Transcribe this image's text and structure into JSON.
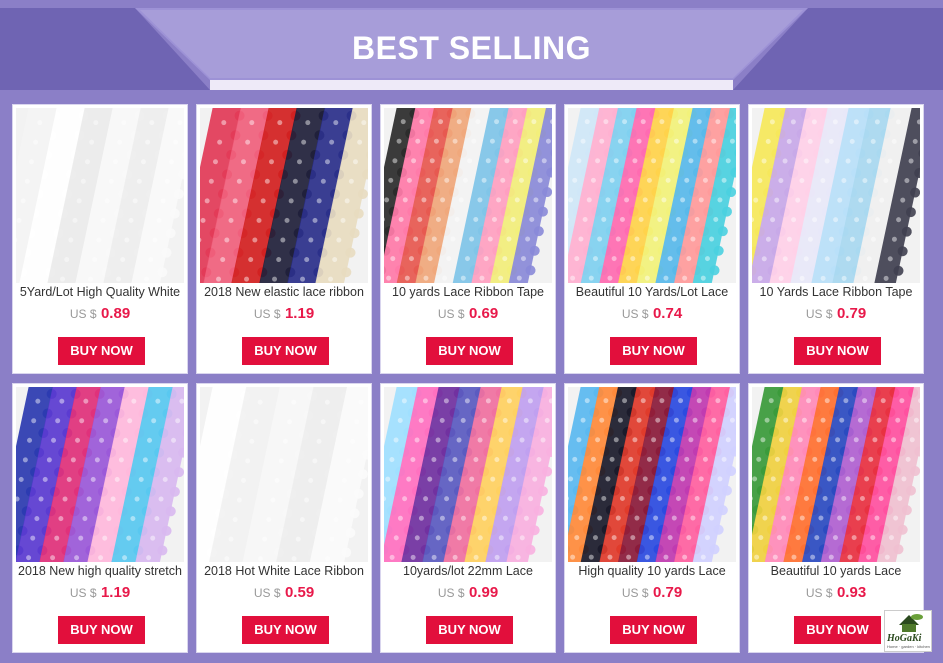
{
  "header": {
    "title": "BEST SELLING"
  },
  "brand": {
    "name": "HoGaKi",
    "tagline": "Home · garden · kitchen"
  },
  "colors": {
    "background": "#8b7fc7",
    "button": "#e20f3c",
    "price": "#e8194a"
  },
  "products": [
    {
      "title": "5Yard/Lot High Quality White",
      "currency": "US $",
      "price": "0.89",
      "button": "BUY NOW"
    },
    {
      "title": "2018 New elastic lace ribbon",
      "currency": "US $",
      "price": "1.19",
      "button": "BUY NOW"
    },
    {
      "title": "10 yards Lace Ribbon Tape",
      "currency": "US $",
      "price": "0.69",
      "button": "BUY NOW"
    },
    {
      "title": "Beautiful 10 Yards/Lot Lace",
      "currency": "US $",
      "price": "0.74",
      "button": "BUY NOW"
    },
    {
      "title": "10 Yards Lace Ribbon Tape",
      "currency": "US $",
      "price": "0.79",
      "button": "BUY NOW"
    },
    {
      "title": "2018 New high quality stretch",
      "currency": "US $",
      "price": "1.19",
      "button": "BUY NOW"
    },
    {
      "title": "2018 Hot White Lace Ribbon",
      "currency": "US $",
      "price": "0.59",
      "button": "BUY NOW"
    },
    {
      "title": "10yards/lot 22mm Lace",
      "currency": "US $",
      "price": "0.99",
      "button": "BUY NOW"
    },
    {
      "title": "High quality 10 yards Lace",
      "currency": "US $",
      "price": "0.79",
      "button": "BUY NOW"
    },
    {
      "title": "Beautiful 10 yards Lace",
      "currency": "US $",
      "price": "0.93",
      "button": "BUY NOW"
    }
  ]
}
